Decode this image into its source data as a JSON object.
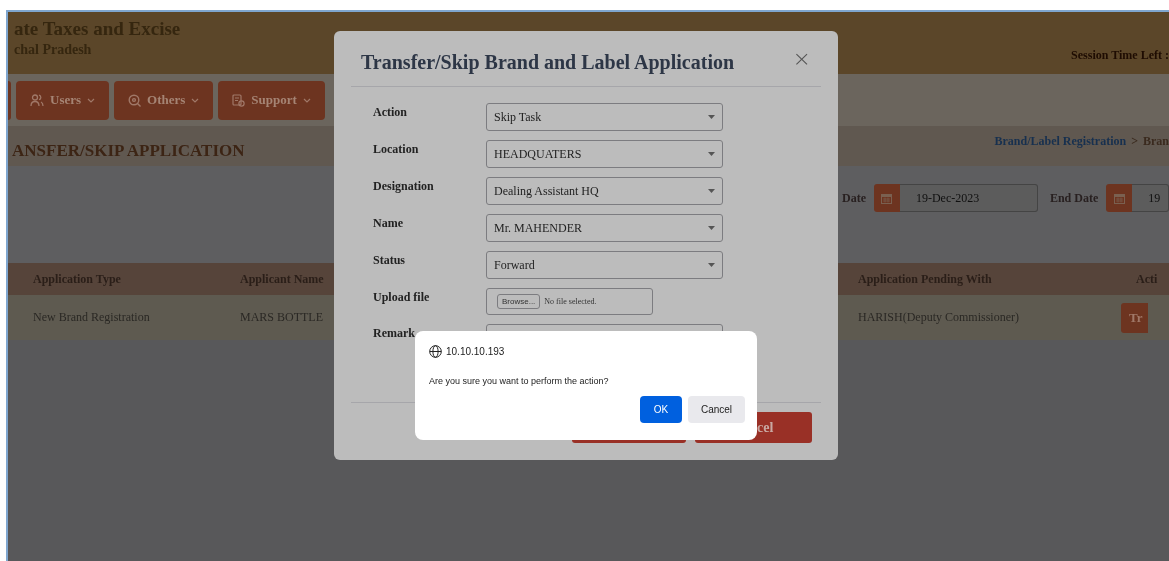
{
  "header": {
    "title": "ate Taxes and Excise",
    "subtitle": "chal Pradesh",
    "session": "Session Time Left :"
  },
  "nav": [
    {
      "kind": "stub"
    },
    {
      "kind": "users",
      "label": "Users"
    },
    {
      "kind": "search",
      "label": "Others"
    },
    {
      "kind": "support",
      "label": "Support"
    }
  ],
  "page_title": "ANSFER/SKIP APPLICATION",
  "breadcrumb": {
    "link": "Brand/Label Registration",
    "separator": ">",
    "current": "Bran"
  },
  "filters": [
    {
      "label": "Date",
      "value": "19-Dec-2023"
    },
    {
      "label": "End Date",
      "value": "19"
    }
  ],
  "table": {
    "columns": [
      "Application Type",
      "Applicant Name",
      "Application Pending With",
      "Acti"
    ],
    "rows": [
      {
        "type": "New Brand Registration",
        "applicant": "MARS BOTTLE",
        "pending_with": "HARISH(Deputy Commissioner)",
        "action": "Tr"
      }
    ]
  },
  "modal": {
    "title": "Transfer/Skip Brand and Label Application",
    "close": "×",
    "fields": [
      {
        "label": "Action",
        "kind": "select",
        "value": "Skip Task"
      },
      {
        "label": "Location",
        "kind": "select",
        "value": "HEADQUATERS"
      },
      {
        "label": "Designation",
        "kind": "select",
        "value": "Dealing Assistant HQ"
      },
      {
        "label": "Name",
        "kind": "select",
        "value": "Mr. MAHENDER"
      },
      {
        "label": "Status",
        "kind": "select",
        "value": "Forward"
      },
      {
        "label": "Upload file",
        "kind": "file",
        "button": "Browse...",
        "value": "No file selected."
      },
      {
        "label": "Remark",
        "kind": "textarea"
      }
    ],
    "buttons": [
      {
        "kind": "covered"
      },
      {
        "kind": "labeled",
        "label": "cel"
      }
    ]
  },
  "alert": {
    "host": "10.10.10.193",
    "message": "Are you sure you want to perform the action?",
    "ok": "OK",
    "cancel": "Cancel"
  }
}
